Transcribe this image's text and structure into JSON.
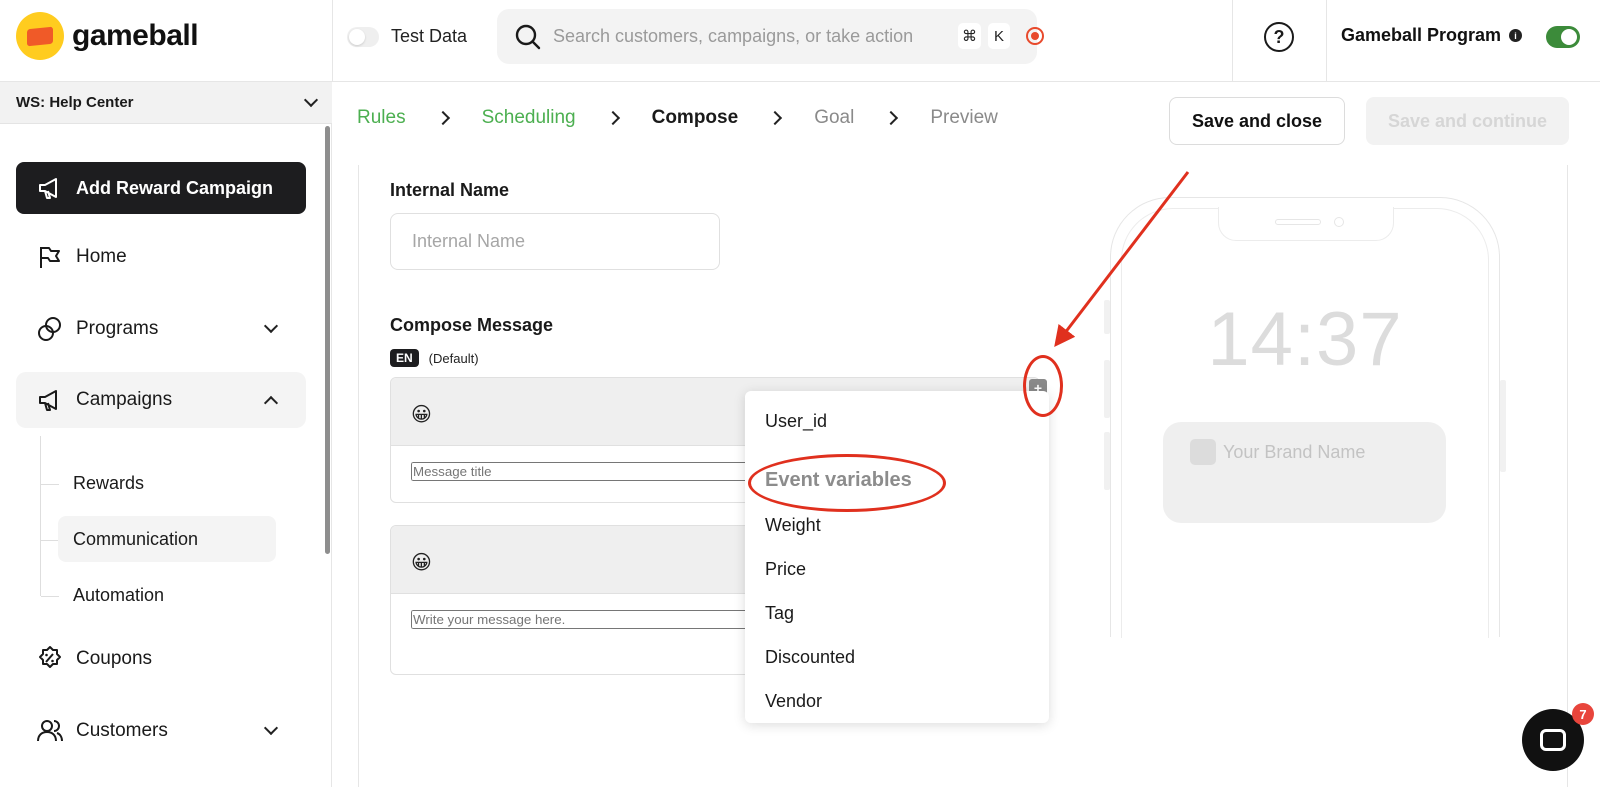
{
  "app": {
    "logo_text": "gameball"
  },
  "topbar": {
    "test_data_label": "Test Data",
    "search_placeholder": "Search customers, campaigns, or take action",
    "shortcut_cmd": "⌘",
    "shortcut_key": "K",
    "help_symbol": "?",
    "program_name": "Gameball Program",
    "info_symbol": "i"
  },
  "sidebar": {
    "workspace": "WS: Help Center",
    "add_button": "Add Reward Campaign",
    "nav": {
      "home": "Home",
      "programs": "Programs",
      "campaigns": "Campaigns",
      "coupons": "Coupons",
      "customers": "Customers"
    },
    "campaign_sub": [
      "Rewards",
      "Communication",
      "Automation"
    ]
  },
  "stepper": [
    "Rules",
    "Scheduling",
    "Compose",
    "Goal",
    "Preview"
  ],
  "actions": {
    "save_close": "Save and close",
    "save_continue": "Save and continue"
  },
  "form": {
    "internal_name_label": "Internal Name",
    "internal_name_placeholder": "Internal Name",
    "compose_label": "Compose Message",
    "lang_chip": "EN",
    "lang_default": "(Default)",
    "emoji": "😀",
    "title_placeholder": "Message title",
    "body_placeholder": "Write your message here.",
    "plus": "+"
  },
  "dropdown": {
    "top_item": "User_id",
    "group_label": "Event variables",
    "items": [
      "Weight",
      "Price",
      "Tag",
      "Discounted",
      "Vendor"
    ]
  },
  "preview": {
    "time": "14:37",
    "brand": "Your Brand Name"
  },
  "chat": {
    "badge": "7"
  },
  "colors": {
    "accent_green": "#4caf50",
    "annotation_red": "#e0301e",
    "logo_yellow": "#ffcc1f",
    "logo_orange": "#f05a28"
  }
}
